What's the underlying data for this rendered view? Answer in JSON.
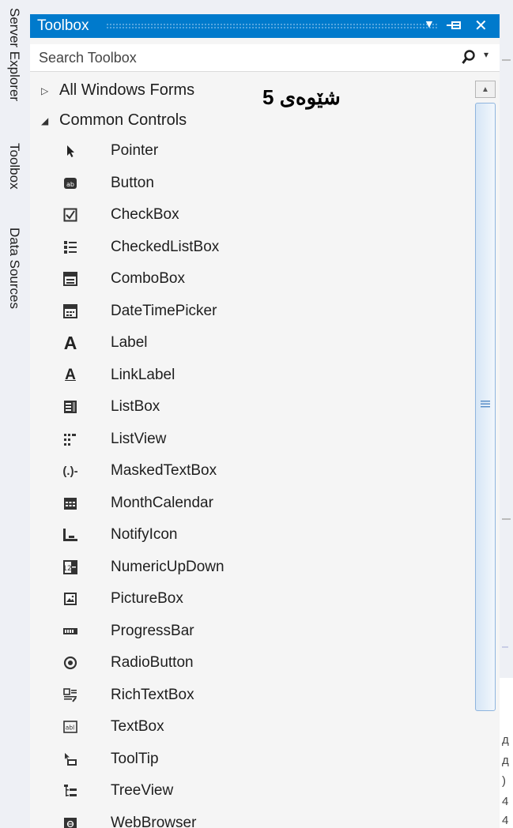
{
  "side_tabs": [
    "Server Explorer",
    "Toolbox",
    "Data Sources"
  ],
  "toolbox": {
    "title": "Toolbox",
    "search_placeholder": "Search Toolbox",
    "groups": [
      {
        "label": "All Windows Forms",
        "expanded": false
      },
      {
        "label": "Common Controls",
        "expanded": true
      }
    ],
    "items": [
      {
        "label": "Pointer",
        "icon": "pointer-icon"
      },
      {
        "label": "Button",
        "icon": "button-icon"
      },
      {
        "label": "CheckBox",
        "icon": "checkbox-icon"
      },
      {
        "label": "CheckedListBox",
        "icon": "checkedlistbox-icon"
      },
      {
        "label": "ComboBox",
        "icon": "combobox-icon"
      },
      {
        "label": "DateTimePicker",
        "icon": "datetimepicker-icon"
      },
      {
        "label": "Label",
        "icon": "label-icon"
      },
      {
        "label": "LinkLabel",
        "icon": "linklabel-icon"
      },
      {
        "label": "ListBox",
        "icon": "listbox-icon"
      },
      {
        "label": "ListView",
        "icon": "listview-icon"
      },
      {
        "label": "MaskedTextBox",
        "icon": "maskedtextbox-icon"
      },
      {
        "label": "MonthCalendar",
        "icon": "monthcalendar-icon"
      },
      {
        "label": "NotifyIcon",
        "icon": "notifyicon-icon"
      },
      {
        "label": "NumericUpDown",
        "icon": "numericupdown-icon"
      },
      {
        "label": "PictureBox",
        "icon": "picturebox-icon"
      },
      {
        "label": "ProgressBar",
        "icon": "progressbar-icon"
      },
      {
        "label": "RadioButton",
        "icon": "radiobutton-icon"
      },
      {
        "label": "RichTextBox",
        "icon": "richtextbox-icon"
      },
      {
        "label": "TextBox",
        "icon": "textbox-icon"
      },
      {
        "label": "ToolTip",
        "icon": "tooltip-icon"
      },
      {
        "label": "TreeView",
        "icon": "treeview-icon"
      },
      {
        "label": "WebBrowser",
        "icon": "webbrowser-icon"
      }
    ]
  },
  "annotation": "شێوەی 5",
  "right_strip_glyphs": [
    "д",
    "д",
    ")",
    "4",
    "4"
  ],
  "colors": {
    "titlebar": "#007acc",
    "scroll_thumb_border": "#8fb5de"
  }
}
